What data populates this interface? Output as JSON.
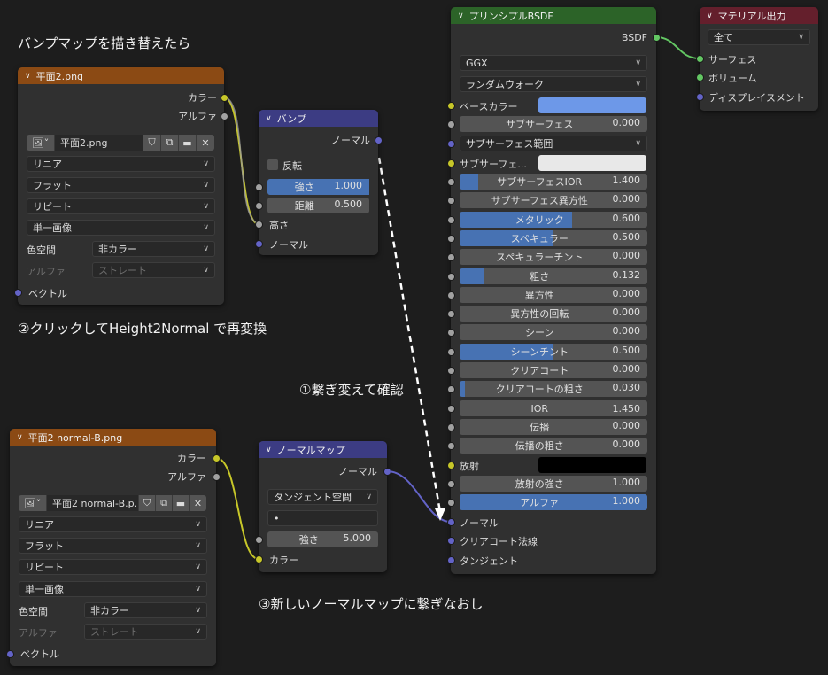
{
  "annotations": {
    "top": "バンプマップを描き替えたら",
    "mid": "②クリックしてHeight2Normal で再変換",
    "connect": "①繋ぎ変えて確認",
    "bottom": "③新しいノーマルマップに繋ぎなおし"
  },
  "tex1": {
    "title": "平面2.png",
    "out_color": "カラー",
    "out_alpha": "アルファ",
    "image_name": "平面2.png",
    "interp": "リニア",
    "proj": "フラット",
    "ext": "リピート",
    "source": "単一画像",
    "colorspace_label": "色空間",
    "colorspace": "非カラー",
    "alpha_label": "アルファ",
    "alpha_mode": "ストレート",
    "in_vector": "ベクトル"
  },
  "bump": {
    "title": "バンプ",
    "out_normal": "ノーマル",
    "invert": "反転",
    "strength_label": "強さ",
    "strength": "1.000",
    "strength_frac": 1.0,
    "distance_label": "距離",
    "distance": "0.500",
    "in_height": "高さ",
    "in_normal": "ノーマル"
  },
  "tex2": {
    "title": "平面2 normal-B.png",
    "out_color": "カラー",
    "out_alpha": "アルファ",
    "image_name": "平面2 normal-B.p...",
    "interp": "リニア",
    "proj": "フラット",
    "ext": "リピート",
    "source": "単一画像",
    "colorspace_label": "色空間",
    "colorspace": "非カラー",
    "alpha_label": "アルファ",
    "alpha_mode": "ストレート",
    "in_vector": "ベクトル"
  },
  "normalmap": {
    "title": "ノーマルマップ",
    "out_normal": "ノーマル",
    "space": "タンジェント空間",
    "uvmap": "•",
    "strength_label": "強さ",
    "strength": "5.000",
    "in_color": "カラー"
  },
  "bsdf": {
    "title": "プリンシプルBSDF",
    "out_bsdf": "BSDF",
    "distribution": "GGX",
    "sss_method": "ランダムウォーク",
    "base_color_label": "ベースカラー",
    "base_color": "#6d98e8",
    "sss_label": "サブサーフェス",
    "sss": "0.000",
    "sss_radius_label": "サブサーフェス範囲",
    "sss_color_label": "サブサーフェ...",
    "sss_color": "#e8e8e8",
    "params": [
      {
        "name": "サブサーフェスIOR",
        "value": "1.400",
        "frac": 0.1
      },
      {
        "name": "サブサーフェス異方性",
        "value": "0.000",
        "frac": 0
      },
      {
        "name": "メタリック",
        "value": "0.600",
        "frac": 0.6
      },
      {
        "name": "スペキュラー",
        "value": "0.500",
        "frac": 0.5
      },
      {
        "name": "スペキュラーチント",
        "value": "0.000",
        "frac": 0
      },
      {
        "name": "粗さ",
        "value": "0.132",
        "frac": 0.132
      },
      {
        "name": "異方性",
        "value": "0.000",
        "frac": 0
      },
      {
        "name": "異方性の回転",
        "value": "0.000",
        "frac": 0
      },
      {
        "name": "シーン",
        "value": "0.000",
        "frac": 0
      },
      {
        "name": "シーンチント",
        "value": "0.500",
        "frac": 0.5
      },
      {
        "name": "クリアコート",
        "value": "0.000",
        "frac": 0
      },
      {
        "name": "クリアコートの粗さ",
        "value": "0.030",
        "frac": 0.03
      },
      {
        "name": "IOR",
        "value": "1.450",
        "frac": 0
      },
      {
        "name": "伝播",
        "value": "0.000",
        "frac": 0
      },
      {
        "name": "伝播の粗さ",
        "value": "0.000",
        "frac": 0
      }
    ],
    "emission_label": "放射",
    "emission_color": "#000000",
    "emission_strength_label": "放射の強さ",
    "emission_strength": "1.000",
    "alpha_label": "アルファ",
    "alpha": "1.000",
    "alpha_frac": 1.0,
    "in_normal": "ノーマル",
    "in_clearcoat_normal": "クリアコート法線",
    "in_tangent": "タンジェント"
  },
  "output": {
    "title": "マテリアル出力",
    "target": "全て",
    "in_surface": "サーフェス",
    "in_volume": "ボリューム",
    "in_displacement": "ディスプレイスメント"
  },
  "colors": {
    "texture_header": "#8b4a14",
    "vector_header": "#3c3c83",
    "shader_header": "#2c6328",
    "output_header": "#641f2c",
    "slider_fill": "#4772b3",
    "wire_color": "#c7c729",
    "wire_vector": "#6363c7",
    "wire_shader": "#63c763"
  }
}
